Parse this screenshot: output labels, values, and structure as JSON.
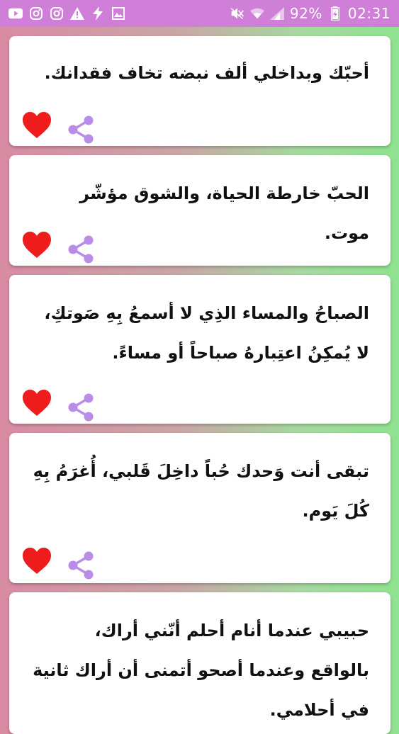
{
  "status_bar": {
    "battery": "92%",
    "time": "02:31",
    "left_icons": [
      "youtube-icon",
      "instagram-icon",
      "instagram-icon",
      "warning-icon",
      "flash-icon",
      "image-icon"
    ],
    "right_icons": [
      "mute-icon",
      "wifi-icon",
      "signal-icon",
      "battery-icon"
    ]
  },
  "colors": {
    "status_bar": "#cf7fd8",
    "heart": "#ee1c1c",
    "share": "#b98ce8",
    "gradient_left": "#d88ba3",
    "gradient_right": "#8fe28f"
  },
  "quotes": [
    {
      "text": "أحبّك وبداخلي ألف نبضه تخاف فقدانك."
    },
    {
      "text": "الحبّ خارطة الحياة، والشوق مؤشّر موت."
    },
    {
      "text": "الصباحُ والمساء الذِي لا أسمعُ بِهِ صَوتكِ، لا يُمكِنُ اعتِبارهُ صباحاً أو مساءً."
    },
    {
      "text": "تبقى أنت وَحدك حُباً داخِلَ قَلبي، أُغرَمُ بِهِ كُلَ يَوم."
    },
    {
      "text": "حبيبي عندما أنام أحلم أنّني أراك، بالواقع وعندما أصحو أتمنى أن أراك ثانية في أحلامي."
    }
  ]
}
